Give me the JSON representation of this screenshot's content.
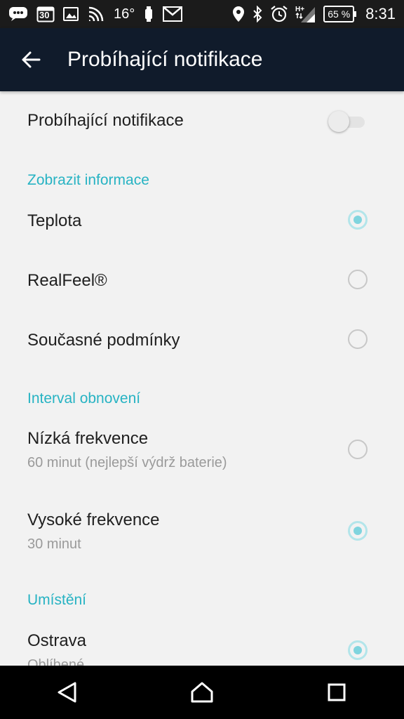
{
  "status_bar": {
    "temperature": "16°",
    "battery": "65 %",
    "time": "8:31",
    "calendar_day": "30",
    "icons": [
      "chat-icon",
      "calendar-icon",
      "image-icon",
      "signal-icon",
      "wear-icon",
      "gmail-icon",
      "location-icon",
      "bluetooth-icon",
      "alarm-icon",
      "network-icon",
      "battery-icon"
    ]
  },
  "app_bar": {
    "title": "Probíhající notifikace",
    "back_icon": "arrow-back-icon"
  },
  "settings": {
    "main_toggle": {
      "label": "Probíhající notifikace",
      "enabled": false
    },
    "display_section": {
      "header": "Zobrazit informace",
      "options": [
        {
          "label": "Teplota",
          "selected": true
        },
        {
          "label": "RealFeel®",
          "selected": false
        },
        {
          "label": "Současné podmínky",
          "selected": false
        }
      ]
    },
    "refresh_section": {
      "header": "Interval obnovení",
      "options": [
        {
          "label": "Nízká frekvence",
          "sub": "60 minut (nejlepší výdrž baterie)",
          "selected": false
        },
        {
          "label": "Vysoké frekvence",
          "sub": "30 minut",
          "selected": true
        }
      ]
    },
    "location_section": {
      "header": "Umístění",
      "options": [
        {
          "label": "Ostrava",
          "sub": "Oblíbené",
          "selected": true
        }
      ]
    }
  },
  "nav_bar": {
    "icons": [
      "back-triangle-icon",
      "home-icon",
      "recents-icon"
    ]
  },
  "colors": {
    "accent": "#27b3c3",
    "app_bar": "#101b2b",
    "background": "#f2f2f2"
  }
}
